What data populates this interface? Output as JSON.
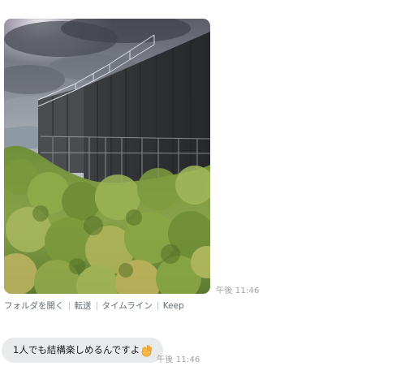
{
  "messages": {
    "photo": {
      "time": "午後 11:46",
      "actions": {
        "open_folder": "フォルダを開く",
        "forward": "転送",
        "timeline": "タイムライン",
        "keep": "Keep"
      }
    },
    "text": {
      "body": "1人でも結構楽しめるんですよ",
      "emoji": "ok-hand-icon",
      "time": "午後 11:46"
    }
  },
  "colors": {
    "bubble_bg": "#e9eaec",
    "timestamp": "#a0a0a0",
    "action_link": "#636a72"
  }
}
